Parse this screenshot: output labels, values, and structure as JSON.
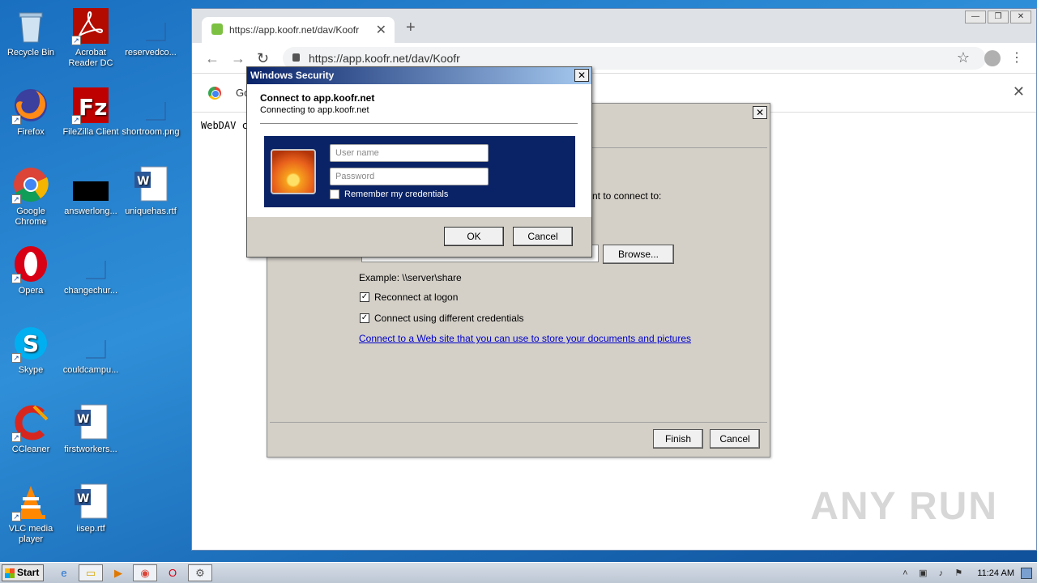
{
  "desktop": {
    "icons": [
      {
        "label": "Recycle Bin",
        "icon": "recycle-bin-icon"
      },
      {
        "label": "Acrobat Reader DC",
        "icon": "acrobat-icon"
      },
      {
        "label": "reservedco...",
        "icon": "blank-file-icon"
      },
      {
        "label": "Firefox",
        "icon": "firefox-icon"
      },
      {
        "label": "FileZilla Client",
        "icon": "filezilla-icon"
      },
      {
        "label": "shortroom.png",
        "icon": "blank-file-icon"
      },
      {
        "label": "Google Chrome",
        "icon": "chrome-icon"
      },
      {
        "label": "answerlong...",
        "icon": "black-file-icon"
      },
      {
        "label": "uniquehas.rtf",
        "icon": "word-doc-icon"
      },
      {
        "label": "Opera",
        "icon": "opera-icon"
      },
      {
        "label": "changechur...",
        "icon": "blank-file-icon"
      },
      {
        "label": "Skype",
        "icon": "skype-icon"
      },
      {
        "label": "couldcampu...",
        "icon": "blank-file-icon"
      },
      {
        "label": "CCleaner",
        "icon": "ccleaner-icon"
      },
      {
        "label": "firstworkers...",
        "icon": "word-doc-icon"
      },
      {
        "label": "VLC media player",
        "icon": "vlc-icon"
      },
      {
        "label": "iisep.rtf",
        "icon": "word-doc-icon"
      }
    ]
  },
  "browser": {
    "tab_title": "https://app.koofr.net/dav/Koofr",
    "url": "https://app.koofr.net/dav/Koofr",
    "infobar_text": "Go",
    "content_text": "WebDAV c",
    "watermark": "ANY RUN"
  },
  "map_dialog": {
    "partial_text": "nt to connect to:",
    "browse_label": "Browse...",
    "example": "Example: \\\\server\\share",
    "reconnect_label": "Reconnect at logon",
    "diffcred_label": "Connect using different credentials",
    "link_text": "Connect to a Web site that you can use to store your documents and pictures",
    "finish_label": "Finish",
    "cancel_label": "Cancel"
  },
  "security_dialog": {
    "title": "Windows Security",
    "heading": "Connect to app.koofr.net",
    "subheading": "Connecting to app.koofr.net",
    "username_placeholder": "User name",
    "password_placeholder": "Password",
    "remember_label": "Remember my credentials",
    "ok_label": "OK",
    "cancel_label": "Cancel"
  },
  "taskbar": {
    "start_label": "Start",
    "clock": "11:24 AM"
  }
}
